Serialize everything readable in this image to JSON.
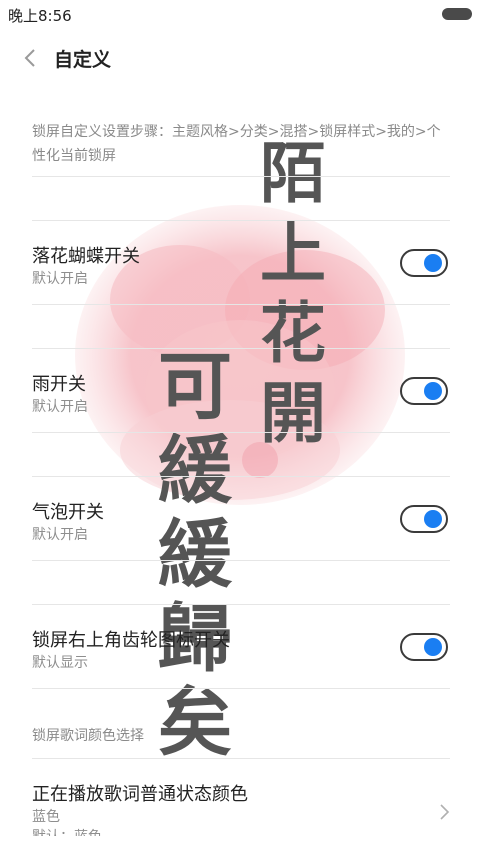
{
  "status": {
    "time": "晚上8:56"
  },
  "header": {
    "title": "自定义"
  },
  "description": "锁屏自定义设置步骤：主题风格>分类>混搭>锁屏样式>我的>个性化当前锁屏",
  "toggles": [
    {
      "title": "落花蝴蝶开关",
      "subtitle": "默认开启",
      "on": true
    },
    {
      "title": "雨开关",
      "subtitle": "默认开启",
      "on": true
    },
    {
      "title": "气泡开关",
      "subtitle": "默认开启",
      "on": true
    },
    {
      "title": "锁屏右上角齿轮图标开关",
      "subtitle": "默认显示",
      "on": true
    }
  ],
  "lyrics_section": {
    "label": "锁屏歌词颜色选择",
    "item_title": "正在播放歌词普通状态颜色",
    "item_value": "蓝色",
    "item_default": "默认：蓝色"
  },
  "calligraphy": {
    "right": [
      "陌",
      "上",
      "花",
      "開"
    ],
    "left": [
      "可",
      "緩",
      "緩",
      "歸",
      "矣"
    ]
  },
  "colors": {
    "accent": "#1a7ef2",
    "flower": "#f4b7be"
  }
}
